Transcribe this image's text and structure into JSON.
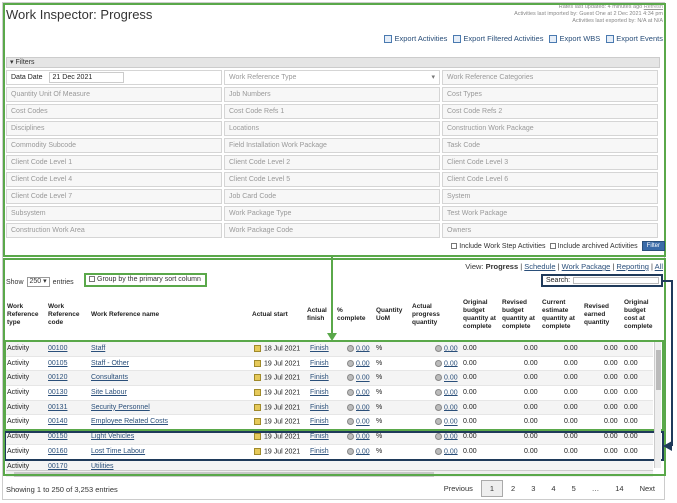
{
  "header": {
    "title": "Work Inspector: Progress",
    "meta_line1": "Rates last updated: 4 minutes ago",
    "meta_refresh": "Refresh",
    "meta_line2": "Activities last imported by: Guest One at 2 Dec 2021 4:34 pm",
    "meta_line3": "Activities last exported by: N/A at N/A"
  },
  "exports": [
    "Export Activities",
    "Export Filtered Activities",
    "Export WBS",
    "Export Events"
  ],
  "filters": {
    "label": "Filters",
    "date_label": "Data Date",
    "date_value": "21 Dec 2021",
    "cells": [
      "Work Reference Type",
      "Work Reference Categories",
      "Quantity Unit Of Measure",
      "Job Numbers",
      "Cost Types",
      "Cost Codes",
      "Cost Code Refs 1",
      "Cost Code Refs 2",
      "Disciplines",
      "Locations",
      "Construction Work Package",
      "Commodity Subcode",
      "Field Installation Work Package",
      "Task Code",
      "Client Code Level 1",
      "Client Code Level 2",
      "Client Code Level 3",
      "Client Code Level 4",
      "Client Code Level 5",
      "Client Code Level 6",
      "Client Code Level 7",
      "Job Card Code",
      "System",
      "Subsystem",
      "Work Package Type",
      "Test Work Package",
      "Construction Work Area",
      "Work Package Code",
      "Owners"
    ],
    "include_steps": "Include Work Step Activities",
    "include_archived": "Include archived Activities",
    "filter_button": "Filter"
  },
  "views": {
    "label": "View:",
    "items": [
      "Progress",
      "Schedule",
      "Work Package",
      "Reporting",
      "All"
    ]
  },
  "table_controls": {
    "show": "Show",
    "show_value": "250",
    "entries": "entries",
    "group": "Group by the primary sort column",
    "search": "Search:"
  },
  "columns": [
    "Work Reference type",
    "Work Reference code",
    "Work Reference name",
    "Actual start",
    "Actual finish",
    "% complete",
    "Quantity UoM",
    "Actual progress quantity",
    "Original budget quantity at complete",
    "Revised budget quantity at complete",
    "Current estimate quantity at complete",
    "Revised earned quantity",
    "Original budget cost at complete"
  ],
  "rows": [
    {
      "type": "Activity",
      "code": "00100",
      "name": "Staff",
      "start": "18 Jul 2021",
      "finish": "Finish",
      "pct": "0.00",
      "uom": "%",
      "apq": "0.00",
      "v1": "0.00",
      "v2": "0.00",
      "v3": "0.00",
      "v4": "0.00",
      "v5": "0.00"
    },
    {
      "type": "Activity",
      "code": "00105",
      "name": "Staff - Other",
      "start": "19 Jul 2021",
      "finish": "Finish",
      "pct": "0.00",
      "uom": "%",
      "apq": "0.00",
      "v1": "0.00",
      "v2": "0.00",
      "v3": "0.00",
      "v4": "0.00",
      "v5": "0.00"
    },
    {
      "type": "Activity",
      "code": "00120",
      "name": "Consultants",
      "start": "19 Jul 2021",
      "finish": "Finish",
      "pct": "0.00",
      "uom": "%",
      "apq": "0.00",
      "v1": "0.00",
      "v2": "0.00",
      "v3": "0.00",
      "v4": "0.00",
      "v5": "0.00"
    },
    {
      "type": "Activity",
      "code": "00130",
      "name": "Site Labour",
      "start": "19 Jul 2021",
      "finish": "Finish",
      "pct": "0.00",
      "uom": "%",
      "apq": "0.00",
      "v1": "0.00",
      "v2": "0.00",
      "v3": "0.00",
      "v4": "0.00",
      "v5": "0.00"
    },
    {
      "type": "Activity",
      "code": "00131",
      "name": "Security Personnel",
      "start": "19 Jul 2021",
      "finish": "Finish",
      "pct": "0.00",
      "uom": "%",
      "apq": "0.00",
      "v1": "0.00",
      "v2": "0.00",
      "v3": "0.00",
      "v4": "0.00",
      "v5": "0.00"
    },
    {
      "type": "Activity",
      "code": "00140",
      "name": "Employee Related Costs",
      "start": "19 Jul 2021",
      "finish": "Finish",
      "pct": "0.00",
      "uom": "%",
      "apq": "0.00",
      "v1": "0.00",
      "v2": "0.00",
      "v3": "0.00",
      "v4": "0.00",
      "v5": "0.00"
    },
    {
      "type": "Activity",
      "code": "00150",
      "name": "Light Vehicles",
      "start": "19 Jul 2021",
      "finish": "Finish",
      "pct": "0.00",
      "uom": "%",
      "apq": "0.00",
      "v1": "0.00",
      "v2": "0.00",
      "v3": "0.00",
      "v4": "0.00",
      "v5": "0.00"
    },
    {
      "type": "Activity",
      "code": "00160",
      "name": "Lost Time Labour",
      "start": "19 Jul 2021",
      "finish": "Finish",
      "pct": "0.00",
      "uom": "%",
      "apq": "0.00",
      "v1": "0.00",
      "v2": "0.00",
      "v3": "0.00",
      "v4": "0.00",
      "v5": "0.00"
    },
    {
      "type": "Activity",
      "code": "00170",
      "name": "Utilities",
      "start": "",
      "finish": "",
      "pct": "",
      "uom": "",
      "apq": "",
      "v1": "",
      "v2": "",
      "v3": "",
      "v4": "",
      "v5": ""
    }
  ],
  "footer": {
    "showing": "Showing 1 to 250 of 3,253 entries",
    "previous": "Previous",
    "pages": [
      "1",
      "2",
      "3",
      "4",
      "5",
      "…",
      "14"
    ],
    "next": "Next"
  }
}
